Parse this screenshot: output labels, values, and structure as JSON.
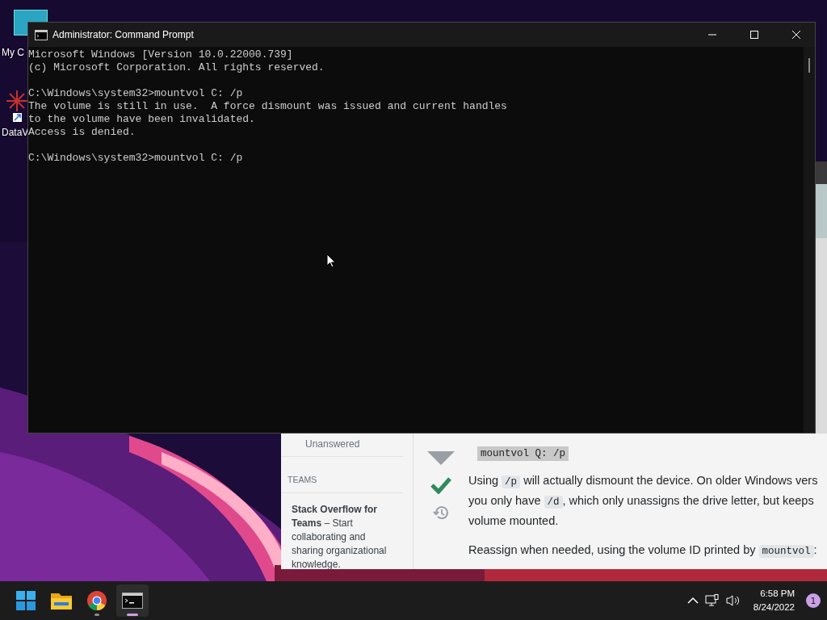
{
  "desktop_icons": [
    {
      "label": "My C"
    },
    {
      "label": "DataV"
    }
  ],
  "console_window": {
    "title": "Administrator: Command Prompt",
    "blocks": [
      [
        "Microsoft Windows [Version 10.0.22000.739]",
        "(c) Microsoft Corporation. All rights reserved."
      ],
      [
        "C:\\Windows\\system32>mountvol C: /p",
        "The volume is still in use.  A force dismount was issued and current handles",
        "to the volume have been invalidated.",
        "Access is denied."
      ],
      [
        "C:\\Windows\\system32>mountvol C: /p"
      ]
    ]
  },
  "browser": {
    "sidebar": {
      "items": [
        {
          "label": "Unanswered",
          "selected": false
        }
      ],
      "section": "TEAMS",
      "promo": "**Stack Overflow for Teams** – Start collaborating and sharing organizational knowledge."
    },
    "answer": {
      "accepted": true,
      "code": "mountvol Q: /p",
      "lines": [
        [
          {
            "kind": "text",
            "text": "Using "
          },
          {
            "kind": "code",
            "text": "/p"
          },
          {
            "kind": "text",
            "text": " will actually dismount the device. On older Windows vers"
          }
        ],
        [
          {
            "kind": "text",
            "text": "you only have "
          },
          {
            "kind": "code",
            "text": "/d"
          },
          {
            "kind": "text",
            "text": ", which only unassigns the drive letter, but keeps"
          }
        ],
        [
          {
            "kind": "text",
            "text": "volume mounted."
          }
        ],
        [
          {
            "kind": "text",
            "text": "Reassign when needed, using the volume ID printed by "
          },
          {
            "kind": "code",
            "text": "mountvol"
          },
          {
            "kind": "text",
            "text": ":"
          }
        ]
      ]
    }
  },
  "taskbar": {
    "apps": [
      {
        "kind": "start",
        "active": false
      },
      {
        "kind": "folder",
        "active": false
      },
      {
        "kind": "browser",
        "active": false
      },
      {
        "kind": "terminal",
        "active": true
      }
    ],
    "time": "6:58 PM",
    "date": "8/24/2022",
    "notifications": "1"
  }
}
